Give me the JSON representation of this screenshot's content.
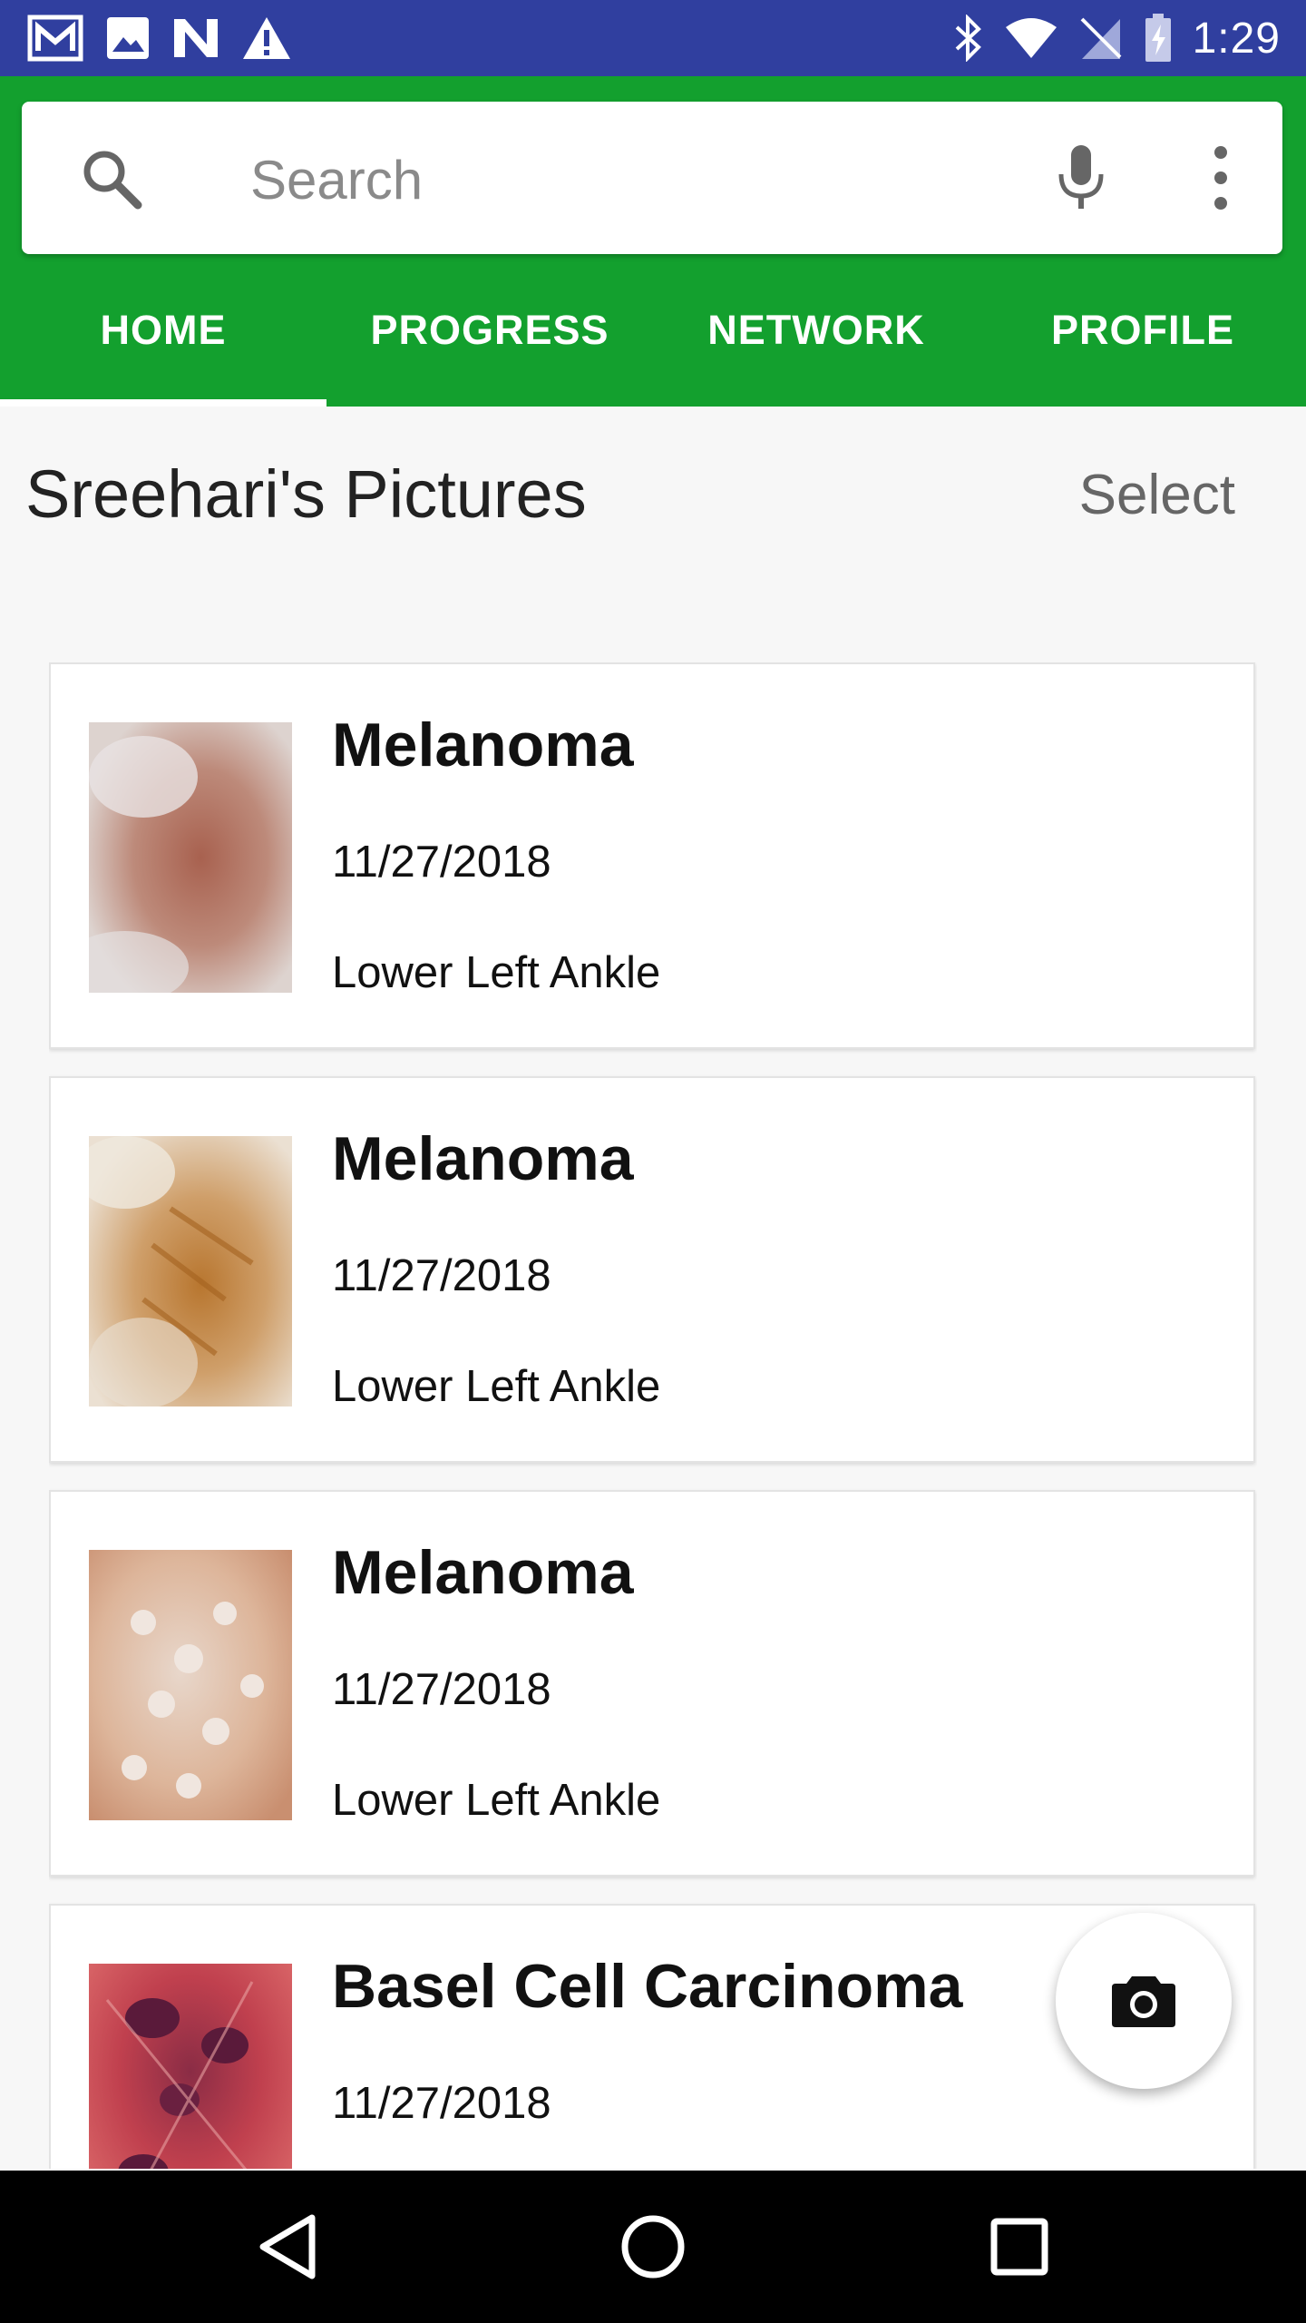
{
  "status_bar": {
    "time": "1:29",
    "icons": [
      "gmail-icon",
      "gallery-icon",
      "n-app-icon",
      "warning-icon",
      "bluetooth-icon",
      "wifi-icon",
      "no-sim-icon",
      "battery-charging-icon"
    ]
  },
  "search": {
    "placeholder": "Search",
    "value": ""
  },
  "tabs": [
    {
      "label": "HOME",
      "active": true
    },
    {
      "label": "PROGRESS",
      "active": false
    },
    {
      "label": "NETWORK",
      "active": false
    },
    {
      "label": "PROFILE",
      "active": false
    }
  ],
  "section": {
    "title": "Sreehari's Pictures",
    "select_label": "Select"
  },
  "cards": [
    {
      "title": "Melanoma",
      "date": "11/27/2018",
      "location": "Lower Left Ankle"
    },
    {
      "title": "Melanoma",
      "date": "11/27/2018",
      "location": "Lower Left Ankle"
    },
    {
      "title": "Melanoma",
      "date": "11/27/2018",
      "location": "Lower Left Ankle"
    },
    {
      "title": "Basel Cell Carcinoma",
      "date": "11/27/2018",
      "location": ""
    }
  ],
  "fab": {
    "icon": "camera-icon"
  },
  "colors": {
    "status_bar": "#303f9f",
    "app_bar": "#13a02e",
    "background": "#f7f7f7"
  }
}
